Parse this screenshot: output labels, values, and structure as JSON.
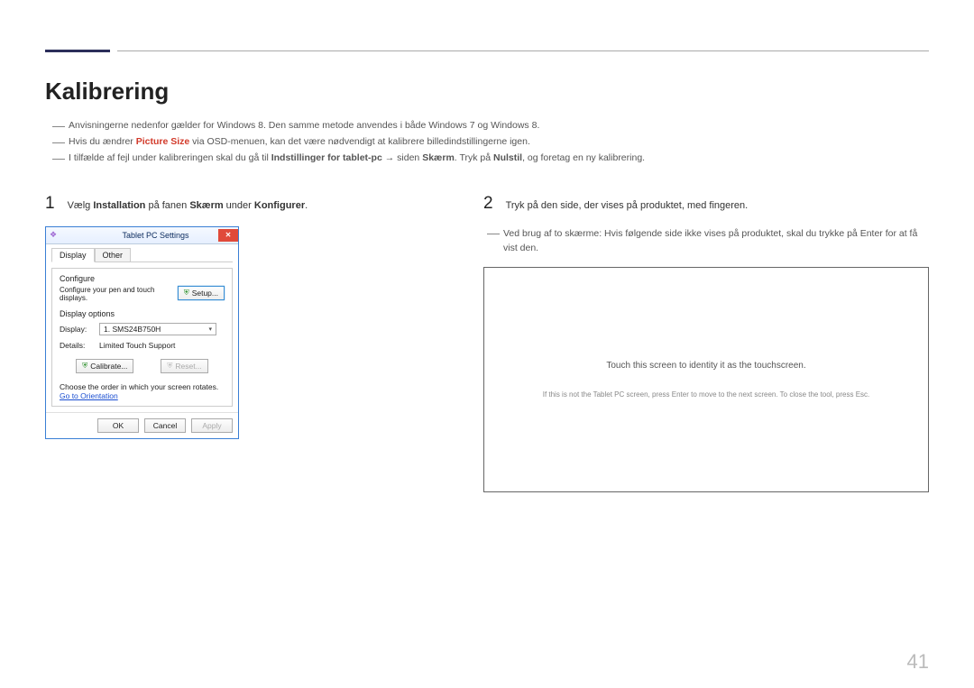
{
  "title": "Kalibrering",
  "notes": {
    "n1": "Anvisningerne nedenfor gælder for Windows 8. Den samme metode anvendes i både Windows 7 og Windows 8.",
    "n2_a": "Hvis du ændrer ",
    "n2_b": "Picture Size",
    "n2_c": " via OSD-menuen, kan det være nødvendigt at kalibrere billedindstillingerne igen.",
    "n3_a": "I tilfælde af fejl under kalibreringen skal du gå til ",
    "n3_b": "Indstillinger for tablet-pc",
    "n3_arrow": " → ",
    "n3_c": "siden ",
    "n3_d": "Skærm",
    "n3_e": ". Tryk på ",
    "n3_f": "Nulstil",
    "n3_g": ", og foretag en ny kalibrering."
  },
  "step1": {
    "num": "1",
    "a": "Vælg ",
    "b": "Installation",
    "c": " på fanen ",
    "d": "Skærm",
    "e": " under ",
    "f": "Konfigurer",
    "g": "."
  },
  "dialog": {
    "title": "Tablet PC Settings",
    "close": "✕",
    "tabs": {
      "display": "Display",
      "other": "Other"
    },
    "configure_label": "Configure",
    "configure_text": "Configure your pen and touch displays.",
    "setup_btn": "Setup...",
    "display_options_label": "Display options",
    "display_label": "Display:",
    "display_value": "1. SMS24B750H",
    "details_label": "Details:",
    "details_value": "Limited Touch Support",
    "calibrate_btn": "Calibrate...",
    "reset_btn": "Reset...",
    "orientation_note": "Choose the order in which your screen rotates.",
    "orientation_link": "Go to Orientation",
    "ok": "OK",
    "cancel": "Cancel",
    "apply": "Apply"
  },
  "step2": {
    "num": "2",
    "text": "Tryk på den side, der vises på produktet, med fingeren.",
    "subnote": "Ved brug af to skærme: Hvis følgende side ikke vises på produktet, skal du trykke på Enter for at få vist den."
  },
  "touchbox": {
    "main": "Touch this screen to identity it as the touchscreen.",
    "sub": "If this is not the Tablet PC screen, press Enter to move to the next screen. To close the tool, press Esc."
  },
  "page_number": "41"
}
